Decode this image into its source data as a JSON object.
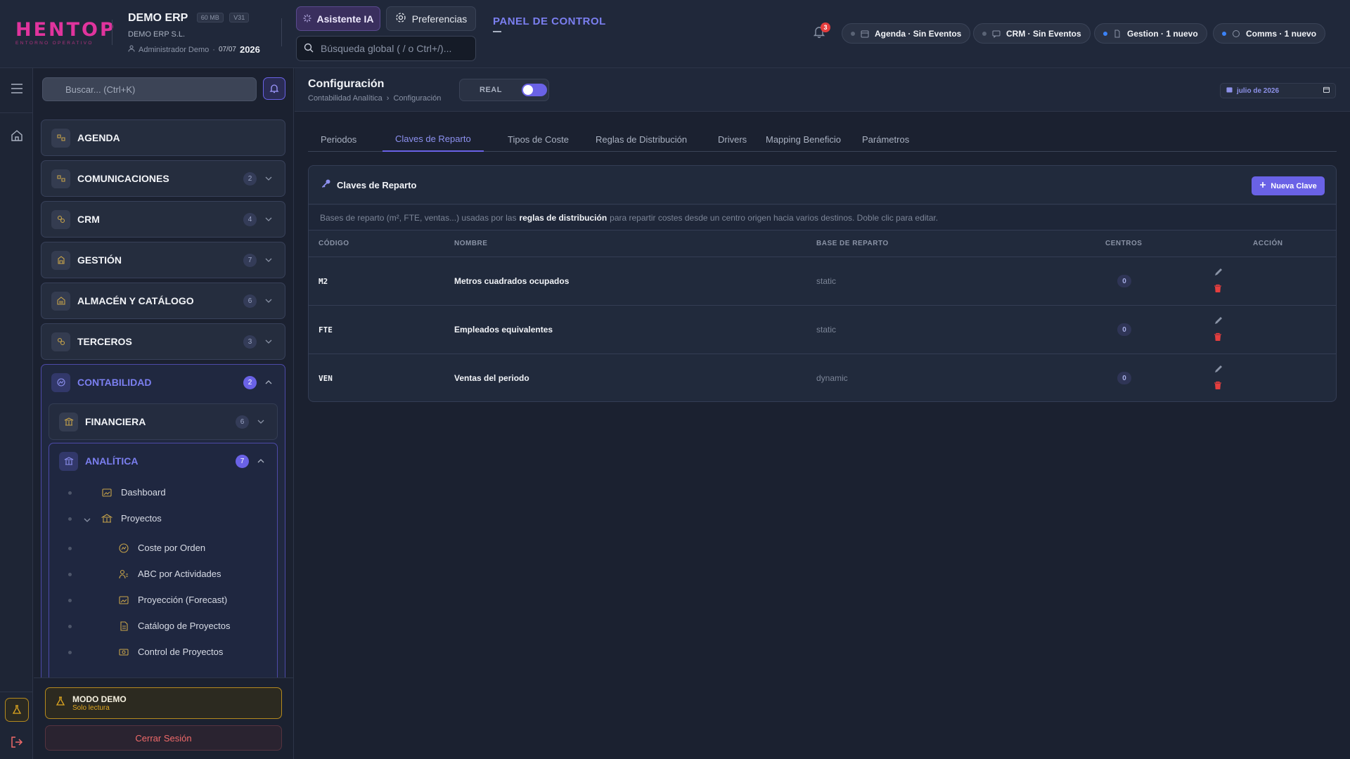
{
  "header": {
    "logo_text": "HENTOP",
    "logo_sub": "ENTORNO OPERATIVO",
    "company_name": "DEMO ERP",
    "badge_size": "60 MB",
    "badge_version": "V31",
    "company_legal": "DEMO ERP S.L.",
    "user": "Administrador Demo",
    "date": "07/07",
    "year": "2026",
    "ai_button": "Asistente IA",
    "prefs_button": "Preferencias",
    "search_placeholder": "Búsqueda global ( / o Ctrl+/)...",
    "panel_title": "PANEL DE CONTROL",
    "notifications_count": "3",
    "chips": [
      {
        "label": "Agenda · Sin Eventos",
        "status": "gray"
      },
      {
        "label": "CRM · Sin Eventos",
        "status": "gray"
      },
      {
        "label": "Gestion · 1 nuevo",
        "status": "blue"
      },
      {
        "label": "Comms · 1 nuevo",
        "status": "blue"
      }
    ]
  },
  "sidebar": {
    "search_placeholder": "Buscar... (Ctrl+K)",
    "items": [
      {
        "label": "AGENDA",
        "count": null
      },
      {
        "label": "COMUNICACIONES",
        "count": "2"
      },
      {
        "label": "CRM",
        "count": "4"
      },
      {
        "label": "GESTIÓN",
        "count": "7"
      },
      {
        "label": "ALMACÉN Y CATÁLOGO",
        "count": "6"
      },
      {
        "label": "TERCEROS",
        "count": "3"
      }
    ],
    "contabilidad": {
      "label": "CONTABILIDAD",
      "count": "2",
      "financiera": {
        "label": "FINANCIERA",
        "count": "6"
      },
      "analitica": {
        "label": "ANALÍTICA",
        "count": "7",
        "leaves": [
          {
            "label": "Dashboard"
          },
          {
            "label": "Proyectos"
          },
          {
            "label": "Coste por Orden"
          },
          {
            "label": "ABC por Actividades"
          },
          {
            "label": "Proyección (Forecast)"
          },
          {
            "label": "Catálogo de Proyectos"
          },
          {
            "label": "Control de Proyectos"
          }
        ]
      }
    },
    "demo_title": "MODO DEMO",
    "demo_sub": "Solo lectura",
    "logout": "Cerrar Sesión"
  },
  "main": {
    "title": "Configuración",
    "crumb_1": "Contabilidad Analítica",
    "crumb_sep": "›",
    "crumb_2": "Configuración",
    "mode_label": "REAL",
    "mode_on": true,
    "date_label": "julio de 2026",
    "tabs": [
      {
        "label": "Periodos",
        "active": false
      },
      {
        "label": "Claves de Reparto",
        "active": true
      },
      {
        "label": "Tipos de Coste",
        "active": false
      },
      {
        "label": "Reglas de Distribución",
        "active": false
      },
      {
        "label": "Drivers",
        "active": false
      },
      {
        "label": "Mapping Beneficio",
        "active": false
      },
      {
        "label": "Parámetros",
        "active": false
      }
    ],
    "card": {
      "title": "Claves de Reparto",
      "new_button": "Nueva Clave",
      "desc_pre": "Bases de reparto (m², FTE, ventas...) usadas por las",
      "desc_bold": "reglas de distribución",
      "desc_post": "para repartir costes desde un centro origen hacia varios destinos. Doble clic para editar.",
      "columns": [
        "CÓDIGO",
        "NOMBRE",
        "BASE DE REPARTO",
        "CENTROS",
        "ACCIÓN"
      ],
      "rows": [
        {
          "code": "M2",
          "name": "Metros cuadrados ocupados",
          "base": "static",
          "centers": "0"
        },
        {
          "code": "FTE",
          "name": "Empleados equivalentes",
          "base": "static",
          "centers": "0"
        },
        {
          "code": "VEN",
          "name": "Ventas del periodo",
          "base": "dynamic",
          "centers": "0"
        }
      ]
    }
  },
  "colors": {
    "accent": "#6a62e6",
    "accent_text": "#7b7ff0",
    "brand": "#e0349d",
    "danger": "#e53e3e",
    "warning": "#e0a820"
  }
}
